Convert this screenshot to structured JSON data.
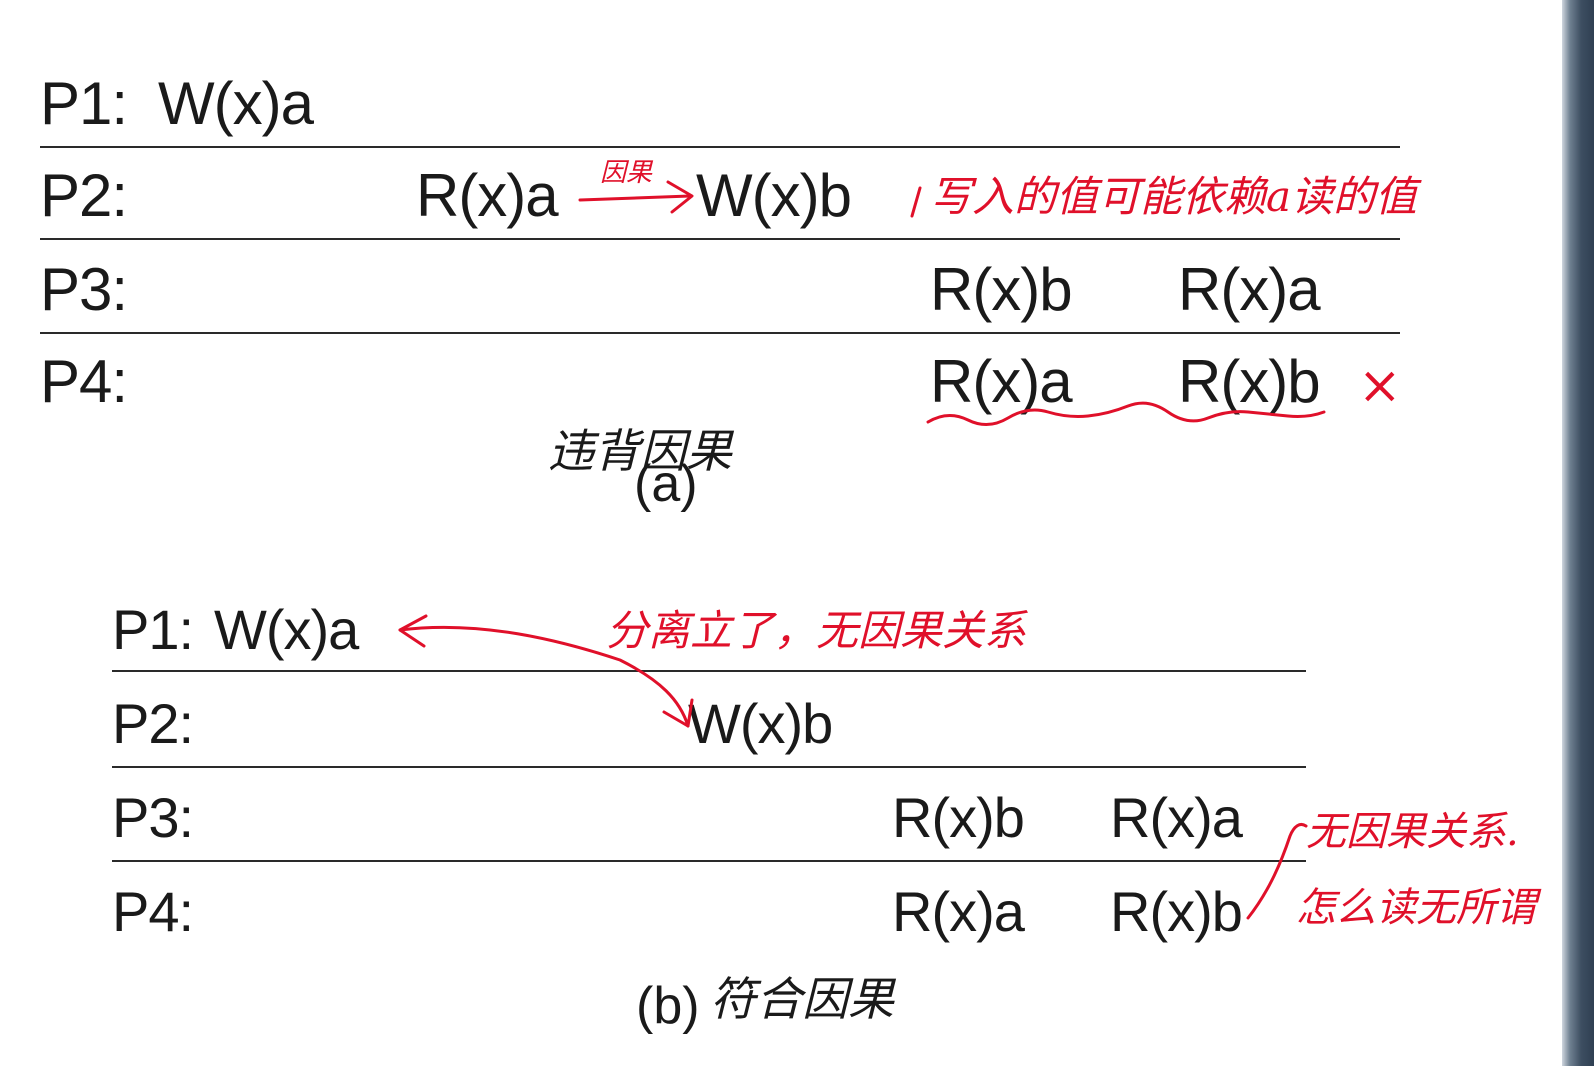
{
  "diagram_a": {
    "rows": [
      {
        "label": "P1:",
        "ops": [
          "W(x)a"
        ]
      },
      {
        "label": "P2:",
        "ops": [
          "R(x)a",
          "W(x)b"
        ]
      },
      {
        "label": "P3:",
        "ops": [
          "R(x)b",
          "R(x)a"
        ]
      },
      {
        "label": "P4:",
        "ops": [
          "R(x)a",
          "R(x)b"
        ]
      }
    ],
    "caption": "(a)",
    "annotations": {
      "causal_arrow_label": "因果",
      "write_dependency_note": "写入的值可能依赖a读的值",
      "violation_mark": "×",
      "handwritten_caption": "违背因果"
    }
  },
  "diagram_b": {
    "rows": [
      {
        "label": "P1:",
        "ops": [
          "W(x)a"
        ]
      },
      {
        "label": "P2:",
        "ops": [
          "W(x)b"
        ]
      },
      {
        "label": "P3:",
        "ops": [
          "R(x)b",
          "R(x)a"
        ]
      },
      {
        "label": "P4:",
        "ops": [
          "R(x)a",
          "R(x)b"
        ]
      }
    ],
    "caption": "(b)",
    "annotations": {
      "independent_note": "分离立了，无因果关系",
      "no_relation_note_line1": "无因果关系.",
      "no_relation_note_line2": "怎么读无所谓",
      "handwritten_caption": "符合因果"
    }
  },
  "colors": {
    "ink": "#1a1a1a",
    "annotation_red": "#e0102a",
    "rule_line": "#2a2a2a"
  }
}
